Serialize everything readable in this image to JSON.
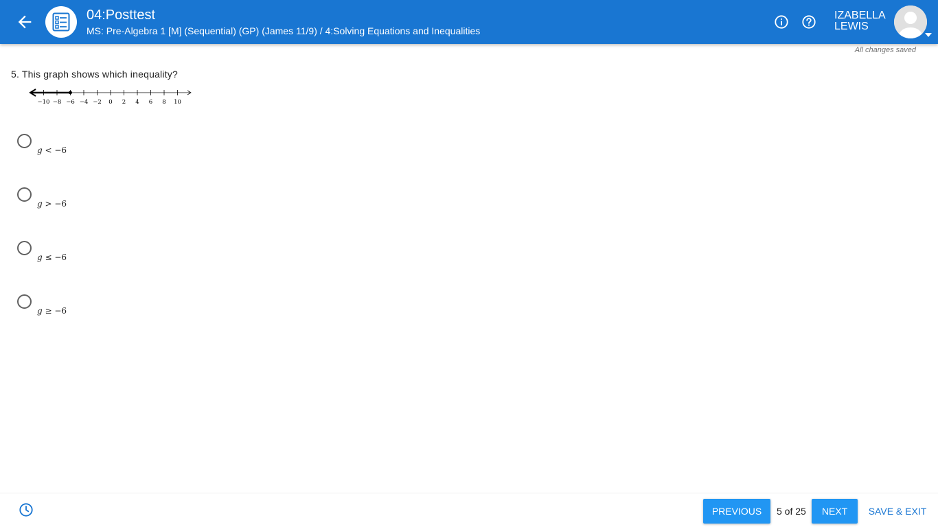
{
  "header": {
    "title": "04:Posttest",
    "subtitle": "MS: Pre-Algebra 1 [M] (Sequential) (GP) (James 11/9) / 4:Solving Equations and Inequalities",
    "user_first": "IZABELLA",
    "user_last": "LEWIS",
    "back_icon": "arrow-left-icon",
    "logo_icon": "checklist-icon",
    "info_icon": "info-icon",
    "help_icon": "help-icon"
  },
  "status": {
    "saved": "All changes saved"
  },
  "question": {
    "text": "5. This graph shows which inequality?",
    "number_line": {
      "tick_labels": [
        "−10",
        "−8",
        "−6",
        "−4",
        "−2",
        "0",
        "2",
        "4",
        "6",
        "8",
        "10"
      ],
      "min": -12,
      "max": 12,
      "closed_point": -6,
      "shaded_direction": "left"
    },
    "choices": [
      {
        "var": "g",
        "rest": " < −6"
      },
      {
        "var": "g",
        "rest": " > −6"
      },
      {
        "var": "g",
        "rest": " ≤ −6"
      },
      {
        "var": "g",
        "rest": " ≥ −6"
      }
    ]
  },
  "footer": {
    "previous_label": "PREVIOUS",
    "page_count": "5 of 25",
    "next_label": "NEXT",
    "save_exit_label": "SAVE & EXIT",
    "clock_icon": "clock-icon"
  },
  "colors": {
    "header_bg": "#1976d2",
    "button_bg": "#2196f3",
    "link": "#1976d2"
  }
}
